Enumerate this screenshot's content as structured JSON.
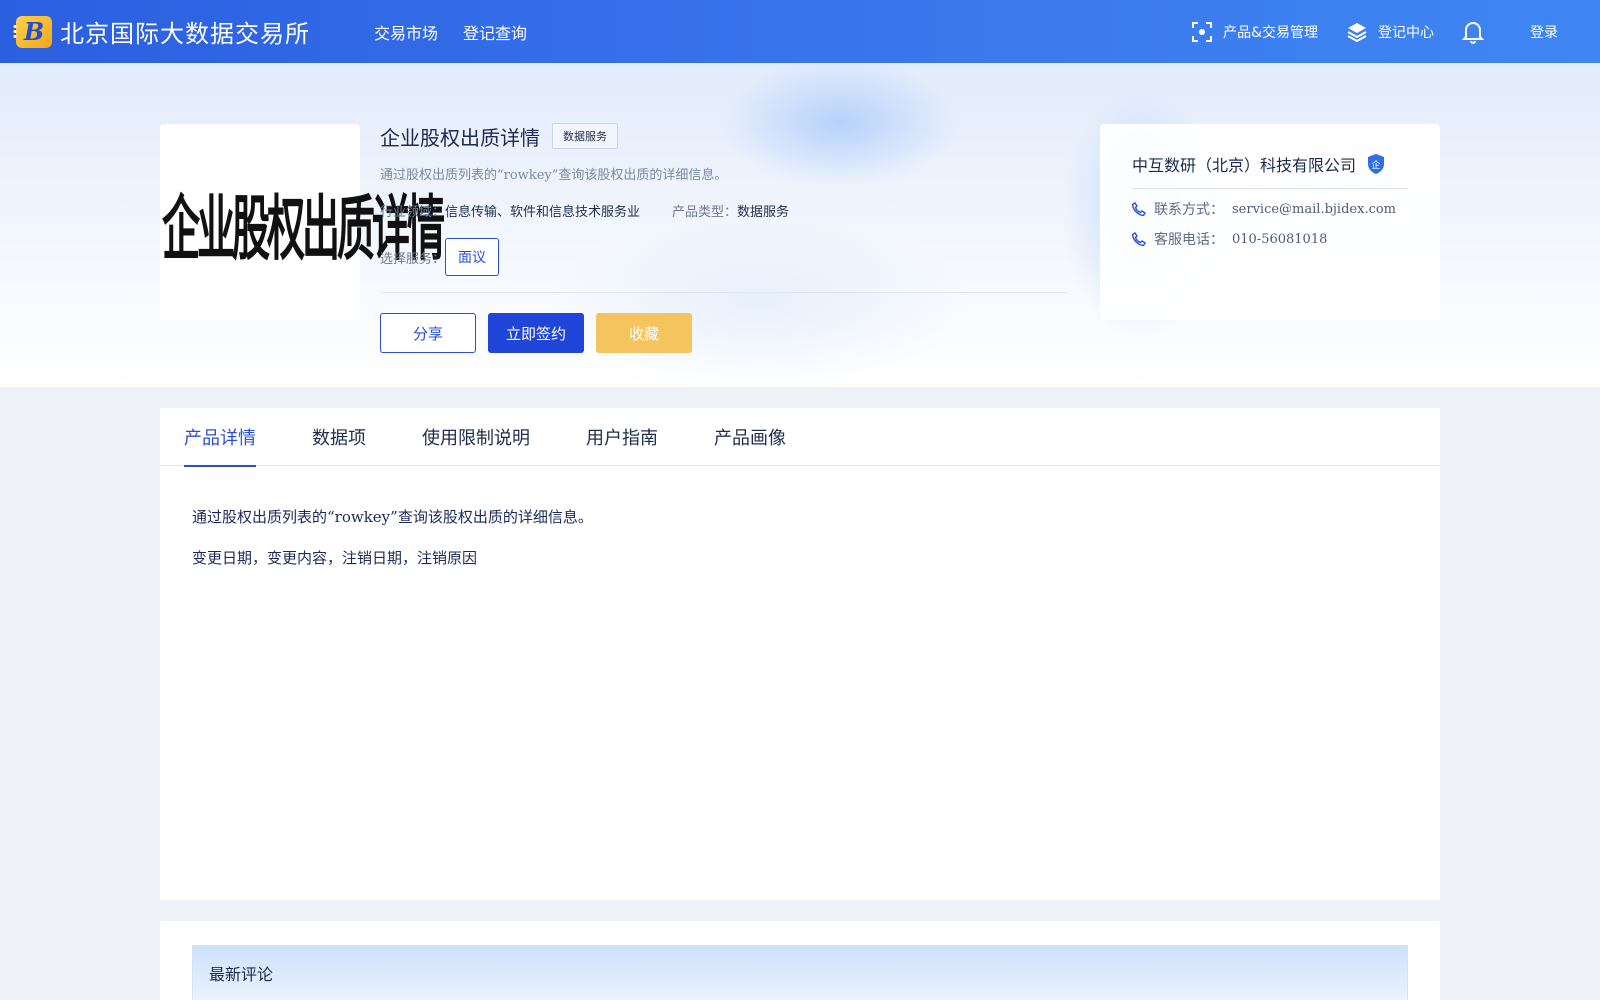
{
  "brand": {
    "name": "北京国际大数据交易所",
    "logo_letter": "B"
  },
  "topnav": {
    "items": [
      "交易市场",
      "登记查询"
    ]
  },
  "topright": {
    "product_mgmt": "产品&交易管理",
    "register_center": "登记中心",
    "login": "登录"
  },
  "product": {
    "image_text": "企业股权出质详情",
    "title": "企业股权出质详情",
    "badge": "数据服务",
    "description": "通过股权出质列表的“rowkey”查询该股权出质的详细信息。",
    "industry_label": "行业领域：",
    "industry_value": "信息传输、软件和信息技术服务业",
    "type_label": "产品类型：",
    "type_value": "数据服务",
    "service_label": "选择服务：",
    "service_option": "面议"
  },
  "actions": {
    "share": "分享",
    "sign": "立即签约",
    "favorite": "收藏"
  },
  "company": {
    "name": "中互数研（北京）科技有限公司",
    "badge_char": "企",
    "contact_label": "联系方式：",
    "contact_value": "service@mail.bjidex.com",
    "phone_label": "客服电话：",
    "phone_value": "010-56081018"
  },
  "tabs": [
    "产品详情",
    "数据项",
    "使用限制说明",
    "用户指南",
    "产品画像"
  ],
  "content": {
    "line1": "通过股权出质列表的“rowkey”查询该股权出质的详细信息。",
    "line2": "变更日期，变更内容，注销日期，注销原因"
  },
  "comments": {
    "title": "最新评论"
  },
  "colors": {
    "primary": "#2a4fd6",
    "topbar": "#3a78ee",
    "favorite": "#f5c45e"
  }
}
